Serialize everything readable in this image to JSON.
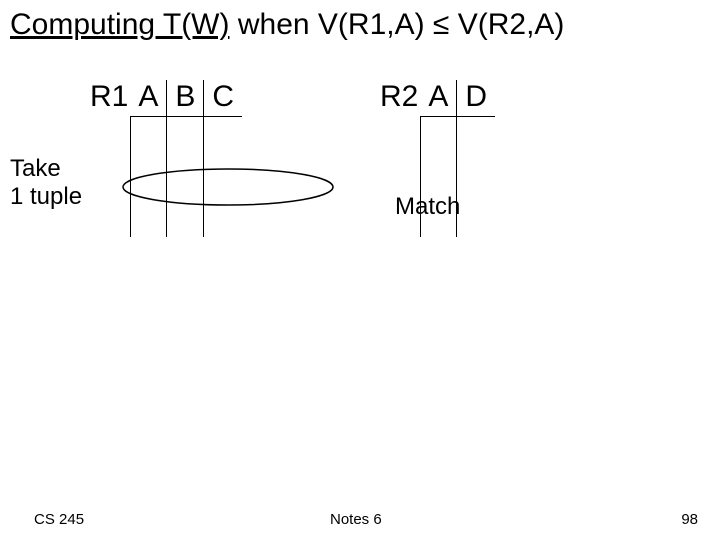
{
  "title": {
    "underlined": "Computing T(W)",
    "rest": "  when V(R1,A) ≤ V(R2,A)"
  },
  "tables": {
    "r1": {
      "name": "R1",
      "columns": [
        "A",
        "B",
        "C"
      ]
    },
    "r2": {
      "name": "R2",
      "columns": [
        "A",
        "D"
      ]
    }
  },
  "annotations": {
    "take_line1": "Take",
    "take_line2": "1 tuple",
    "match": "Match"
  },
  "footer": {
    "course": "CS 245",
    "notes": "Notes 6",
    "page": "98"
  }
}
